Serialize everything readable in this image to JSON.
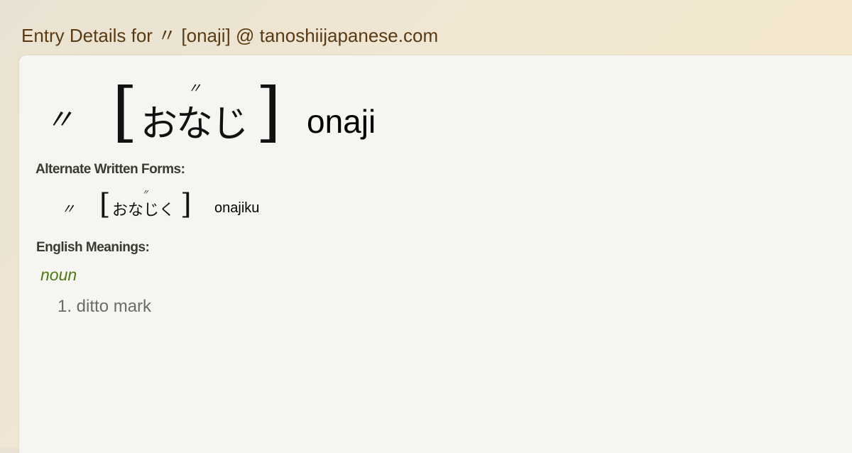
{
  "page": {
    "title": "Entry Details for 〃 [onaji] @ tanoshiijapanese.com"
  },
  "entry": {
    "kanji": "〃",
    "bracket_open": "[",
    "bracket_close": "]",
    "kana": "おなじ",
    "dakuten_mark": "〃",
    "romaji": "onaji"
  },
  "alternate_forms": {
    "label": "Alternate Written Forms:",
    "items": [
      {
        "kanji": "〃",
        "bracket_open": "[",
        "bracket_close": "]",
        "kana": "おなじく",
        "dakuten_mark": "〃",
        "romaji": "onajiku"
      }
    ]
  },
  "meanings": {
    "label": "English Meanings:",
    "part_of_speech": "noun",
    "definitions": [
      "1. ditto mark"
    ]
  },
  "colors": {
    "title": "#5a3a12",
    "part_of_speech": "#4c7a12",
    "definition": "#6a6a6a",
    "panel_bg": "#f7f5f1",
    "page_bg": "#f1e8d3"
  }
}
